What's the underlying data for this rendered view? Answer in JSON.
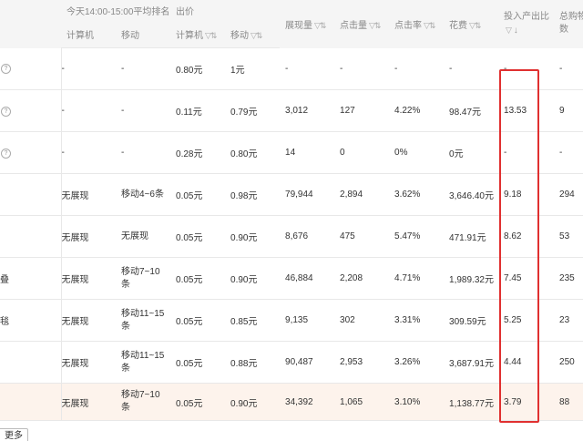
{
  "header": {
    "rank_group": "今天14:00-15:00平均排名",
    "bid_group": "出价",
    "rank_pc": "计算机",
    "rank_mobile": "移动",
    "bid_pc": "计算机",
    "bid_mobile": "移动",
    "impressions": "展现量",
    "clicks": "点击量",
    "ctr": "点击率",
    "cost": "花费",
    "roi": "投入产出比",
    "roi_sort_arrow": "↓",
    "carts": "总购物车数"
  },
  "sort_icon": "▽⇅",
  "rows": [
    {
      "name": "",
      "help": true,
      "rank_pc": "-",
      "rank_mobile": "-",
      "bid_pc": "0.80元",
      "bid_mobile": "1元",
      "impressions": "-",
      "clicks": "-",
      "ctr": "-",
      "cost": "-",
      "roi": "-",
      "carts": "-"
    },
    {
      "name": "",
      "help": true,
      "rank_pc": "-",
      "rank_mobile": "-",
      "bid_pc": "0.11元",
      "bid_mobile": "0.79元",
      "impressions": "3,012",
      "clicks": "127",
      "ctr": "4.22%",
      "cost": "98.47元",
      "roi": "13.53",
      "carts": "9"
    },
    {
      "name": "",
      "help": true,
      "rank_pc": "-",
      "rank_mobile": "-",
      "bid_pc": "0.28元",
      "bid_mobile": "0.80元",
      "impressions": "14",
      "clicks": "0",
      "ctr": "0%",
      "cost": "0元",
      "roi": "-",
      "carts": "-"
    },
    {
      "name": "",
      "help": false,
      "rank_pc": "无展现",
      "rank_mobile": "移动4~6条",
      "bid_pc": "0.05元",
      "bid_mobile": "0.98元",
      "impressions": "79,944",
      "clicks": "2,894",
      "ctr": "3.62%",
      "cost": "3,646.40元",
      "roi": "9.18",
      "carts": "294"
    },
    {
      "name": "",
      "help": false,
      "rank_pc": "无展现",
      "rank_mobile": "无展现",
      "bid_pc": "0.05元",
      "bid_mobile": "0.90元",
      "impressions": "8,676",
      "clicks": "475",
      "ctr": "5.47%",
      "cost": "471.91元",
      "roi": "8.62",
      "carts": "53"
    },
    {
      "name": "叠",
      "help": false,
      "rank_pc": "无展现",
      "rank_mobile": "移动7~10条",
      "bid_pc": "0.05元",
      "bid_mobile": "0.90元",
      "impressions": "46,884",
      "clicks": "2,208",
      "ctr": "4.71%",
      "cost": "1,989.32元",
      "roi": "7.45",
      "carts": "235"
    },
    {
      "name": "毯",
      "help": false,
      "rank_pc": "无展现",
      "rank_mobile": "移动11~15条",
      "bid_pc": "0.05元",
      "bid_mobile": "0.85元",
      "impressions": "9,135",
      "clicks": "302",
      "ctr": "3.31%",
      "cost": "309.59元",
      "roi": "5.25",
      "carts": "23"
    },
    {
      "name": "",
      "help": false,
      "rank_pc": "无展现",
      "rank_mobile": "移动11~15条",
      "bid_pc": "0.05元",
      "bid_mobile": "0.88元",
      "impressions": "90,487",
      "clicks": "2,953",
      "ctr": "3.26%",
      "cost": "3,687.91元",
      "roi": "4.44",
      "carts": "250"
    },
    {
      "name": "",
      "help": false,
      "rank_pc": "无展现",
      "rank_mobile": "移动7~10条",
      "bid_pc": "0.05元",
      "bid_mobile": "0.90元",
      "impressions": "34,392",
      "clicks": "1,065",
      "ctr": "3.10%",
      "cost": "1,138.77元",
      "roi": "3.79",
      "carts": "88"
    }
  ],
  "more_button": "更多",
  "highlight_color": "#e03030"
}
